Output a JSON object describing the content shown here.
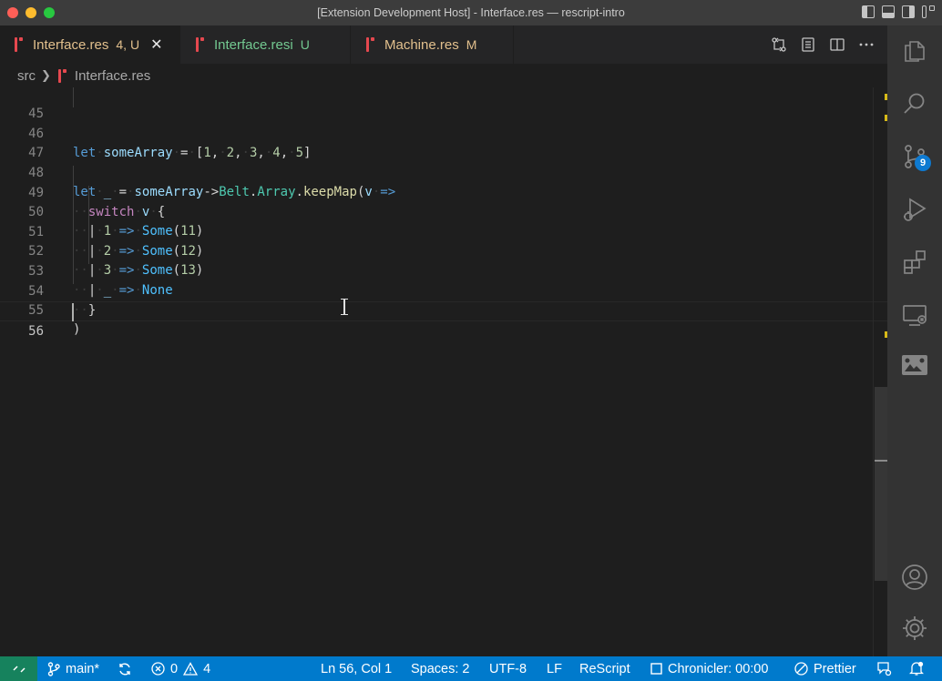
{
  "window": {
    "title": "[Extension Development Host] - Interface.res — rescript-intro"
  },
  "tabs": [
    {
      "label": "Interface.res",
      "status": "4, U",
      "color": "#e2c08d",
      "active": true,
      "close": "✕"
    },
    {
      "label": "Interface.resi",
      "status": "U",
      "color": "#73c991",
      "active": false
    },
    {
      "label": "Machine.res",
      "status": "M",
      "color": "#e2c08d",
      "active": false
    }
  ],
  "breadcrumb": {
    "folder": "src",
    "file": "Interface.res"
  },
  "editor": {
    "lines": [
      {
        "n": "45"
      },
      {
        "n": "46"
      },
      {
        "n": "47"
      },
      {
        "n": "48"
      },
      {
        "n": "49"
      },
      {
        "n": "50"
      },
      {
        "n": "51"
      },
      {
        "n": "52"
      },
      {
        "n": "53"
      },
      {
        "n": "54"
      },
      {
        "n": "55"
      },
      {
        "n": "56"
      }
    ],
    "current_line": "56"
  },
  "activity": {
    "scm_badge": "9"
  },
  "statusbar": {
    "branch": "main*",
    "errors": "0",
    "warnings": "4",
    "position": "Ln 56, Col 1",
    "spaces": "Spaces: 2",
    "encoding": "UTF-8",
    "eol": "LF",
    "language": "ReScript",
    "chronicler": "Chronicler: 00:00",
    "prettier": "Prettier"
  },
  "colors": {
    "statusbar": "#007acc",
    "remote": "#16825d",
    "modified": "#e2c08d",
    "untracked": "#73c991"
  }
}
